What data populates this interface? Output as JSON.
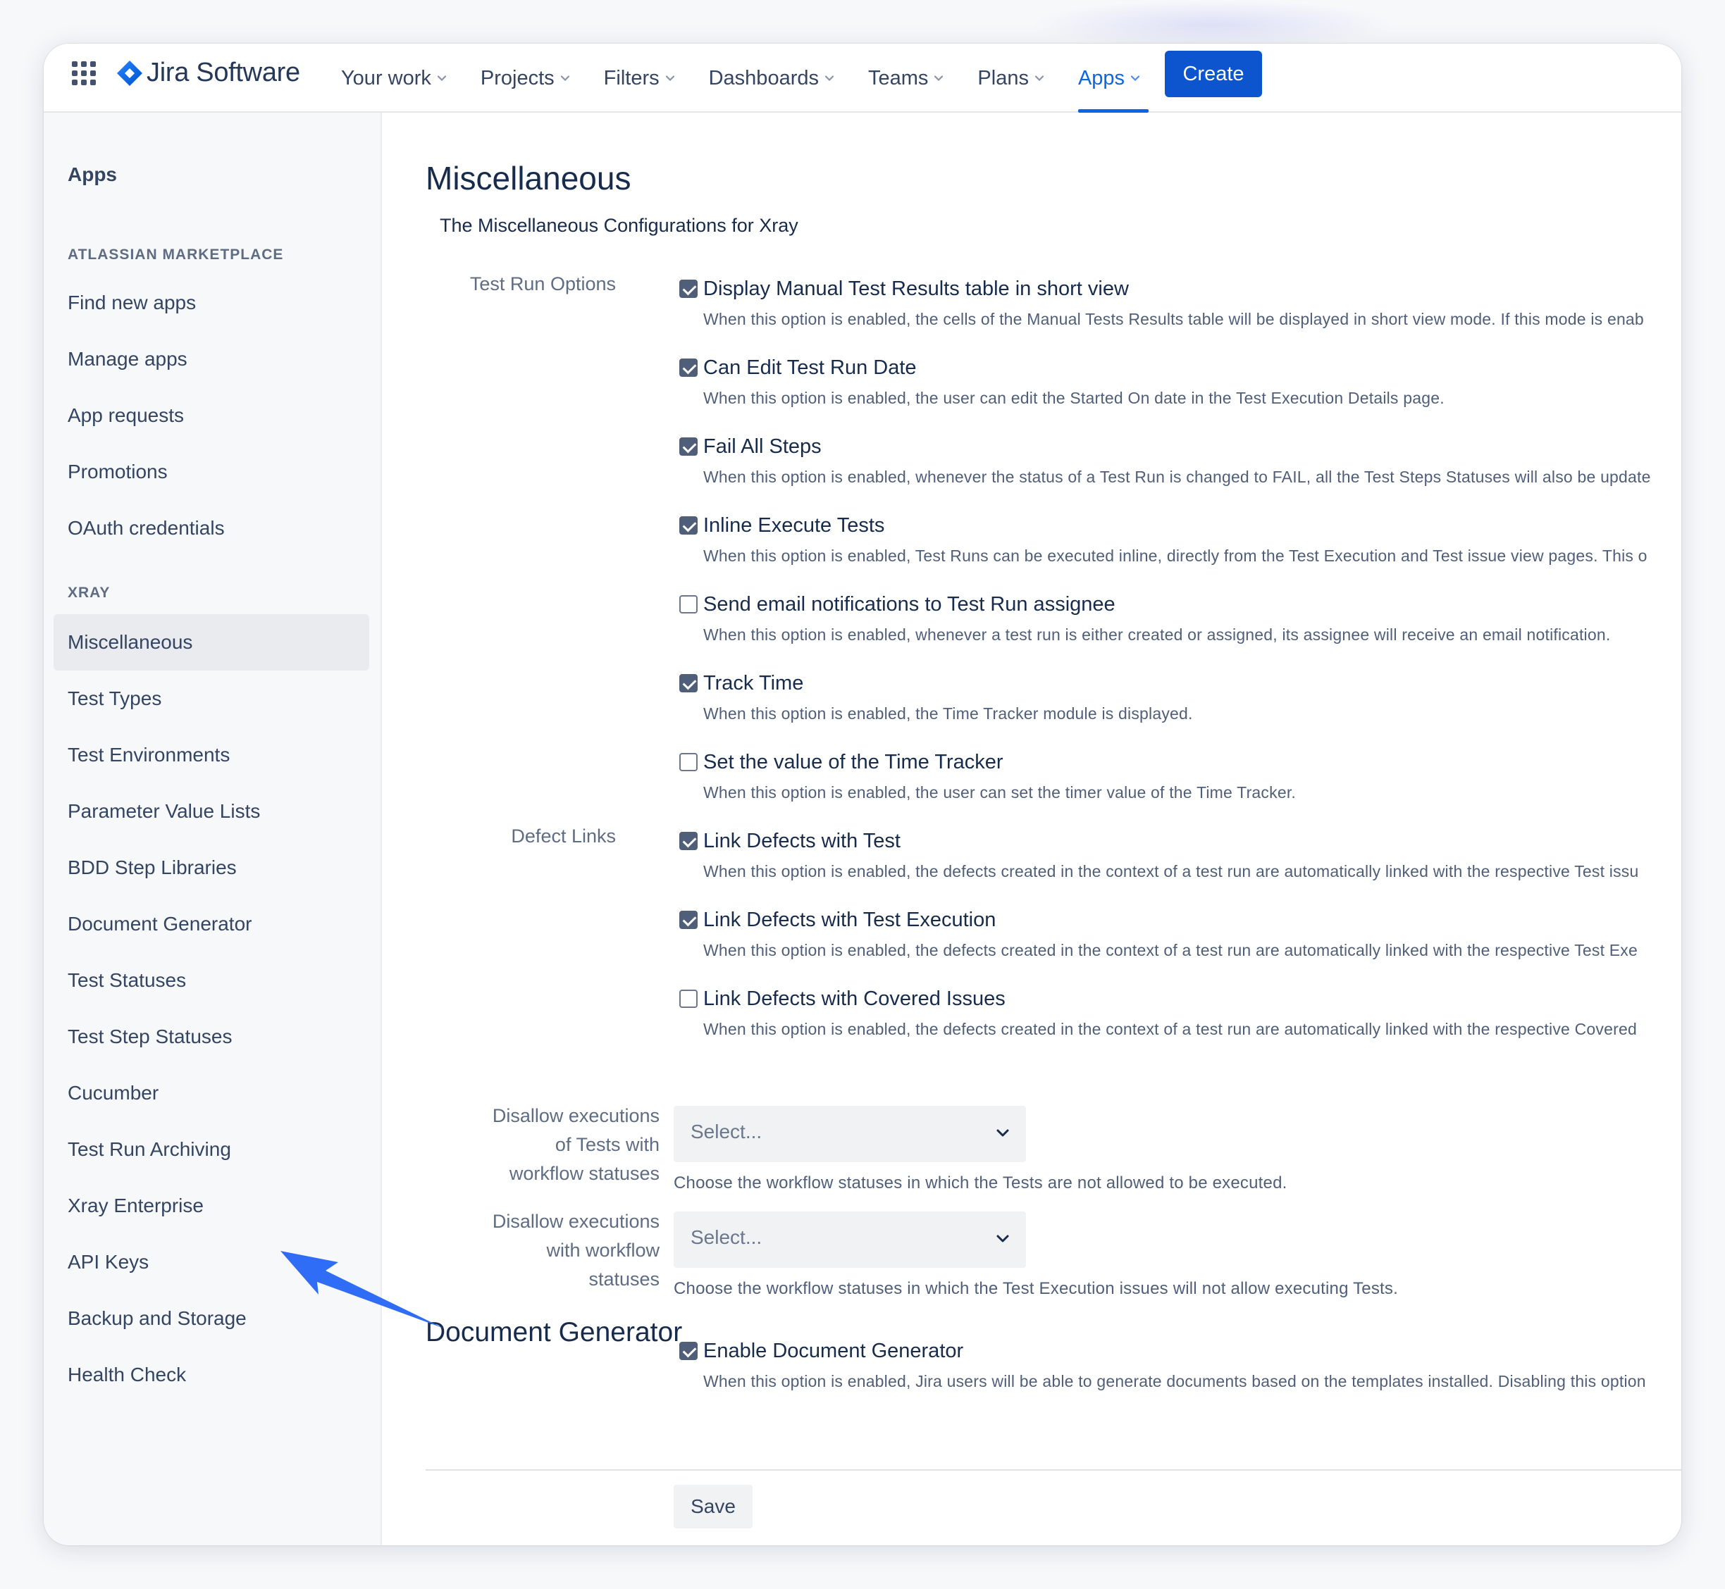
{
  "colors": {
    "brand_blue": "#0c66e4",
    "create_button": "#0c55cf",
    "annotation_arrow": "#2f6df6"
  },
  "topnav": {
    "brand": "Jira Software",
    "items": [
      {
        "label": "Your work",
        "active": false
      },
      {
        "label": "Projects",
        "active": false
      },
      {
        "label": "Filters",
        "active": false
      },
      {
        "label": "Dashboards",
        "active": false
      },
      {
        "label": "Teams",
        "active": false
      },
      {
        "label": "Plans",
        "active": false
      },
      {
        "label": "Apps",
        "active": true
      }
    ],
    "create_label": "Create",
    "icons": [
      "app-switcher-grid-icon",
      "jira-logo-icon",
      "chevron-down-icon"
    ]
  },
  "sidebar": {
    "heading": "Apps",
    "sections": [
      {
        "title": "ATLASSIAN MARKETPLACE",
        "items": [
          "Find new apps",
          "Manage apps",
          "App requests",
          "Promotions",
          "OAuth credentials"
        ]
      },
      {
        "title": "XRAY",
        "items": [
          "Miscellaneous",
          "Test Types",
          "Test Environments",
          "Parameter Value Lists",
          "BDD Step Libraries",
          "Document Generator",
          "Test Statuses",
          "Test Step Statuses",
          "Cucumber",
          "Test Run Archiving",
          "Xray Enterprise",
          "API Keys",
          "Backup and Storage",
          "Health Check"
        ]
      }
    ],
    "selected": "Miscellaneous"
  },
  "main": {
    "title": "Miscellaneous",
    "subtitle": "The Miscellaneous Configurations for Xray",
    "test_run_options": {
      "label": "Test Run Options",
      "options": [
        {
          "label": "Display Manual Test Results table in short view",
          "checked": true,
          "desc": "When this option is enabled, the cells of the Manual Tests Results table will be displayed in short view mode. If this mode is enab"
        },
        {
          "label": "Can Edit Test Run Date",
          "checked": true,
          "desc": "When this option is enabled, the user can edit the Started On date in the Test Execution Details page."
        },
        {
          "label": "Fail All Steps",
          "checked": true,
          "desc": "When this option is enabled, whenever the status of a Test Run is changed to FAIL, all the Test Steps Statuses will also be update"
        },
        {
          "label": "Inline Execute Tests",
          "checked": true,
          "desc": "When this option is enabled, Test Runs can be executed inline, directly from the Test Execution and Test issue view pages. This o"
        },
        {
          "label": "Send email notifications to Test Run assignee",
          "checked": false,
          "desc": "When this option is enabled, whenever a test run is either created or assigned, its assignee will receive an email notification."
        },
        {
          "label": "Track Time",
          "checked": true,
          "desc": "When this option is enabled, the Time Tracker module is displayed."
        },
        {
          "label": "Set the value of the Time Tracker",
          "checked": false,
          "desc": "When this option is enabled, the user can set the timer value of the Time Tracker."
        }
      ]
    },
    "defect_links": {
      "label": "Defect Links",
      "options": [
        {
          "label": "Link Defects with Test",
          "checked": true,
          "desc": "When this option is enabled, the defects created in the context of a test run are automatically linked with the respective Test issu"
        },
        {
          "label": "Link Defects with Test Execution",
          "checked": true,
          "desc": "When this option is enabled, the defects created in the context of a test run are automatically linked with the respective Test Exe"
        },
        {
          "label": "Link Defects with Covered Issues",
          "checked": false,
          "desc": "When this option is enabled, the defects created in the context of a test run are automatically linked with the respective Covered"
        }
      ]
    },
    "selects": [
      {
        "label_lines": [
          "Disallow executions",
          "of Tests with",
          "workflow statuses"
        ],
        "placeholder": "Select...",
        "help": "Choose the workflow statuses in which the Tests are not allowed to be executed."
      },
      {
        "label_lines": [
          "Disallow executions",
          "with workflow",
          "statuses"
        ],
        "placeholder": "Select...",
        "help": "Choose the workflow statuses in which the Test Execution issues will not allow executing Tests."
      }
    ],
    "doc_generator": {
      "title": "Document Generator",
      "option": {
        "label": "Enable Document Generator",
        "checked": true,
        "desc": "When this option is enabled, Jira users will be able to generate documents based on the templates installed. Disabling this option"
      }
    },
    "save_label": "Save"
  }
}
